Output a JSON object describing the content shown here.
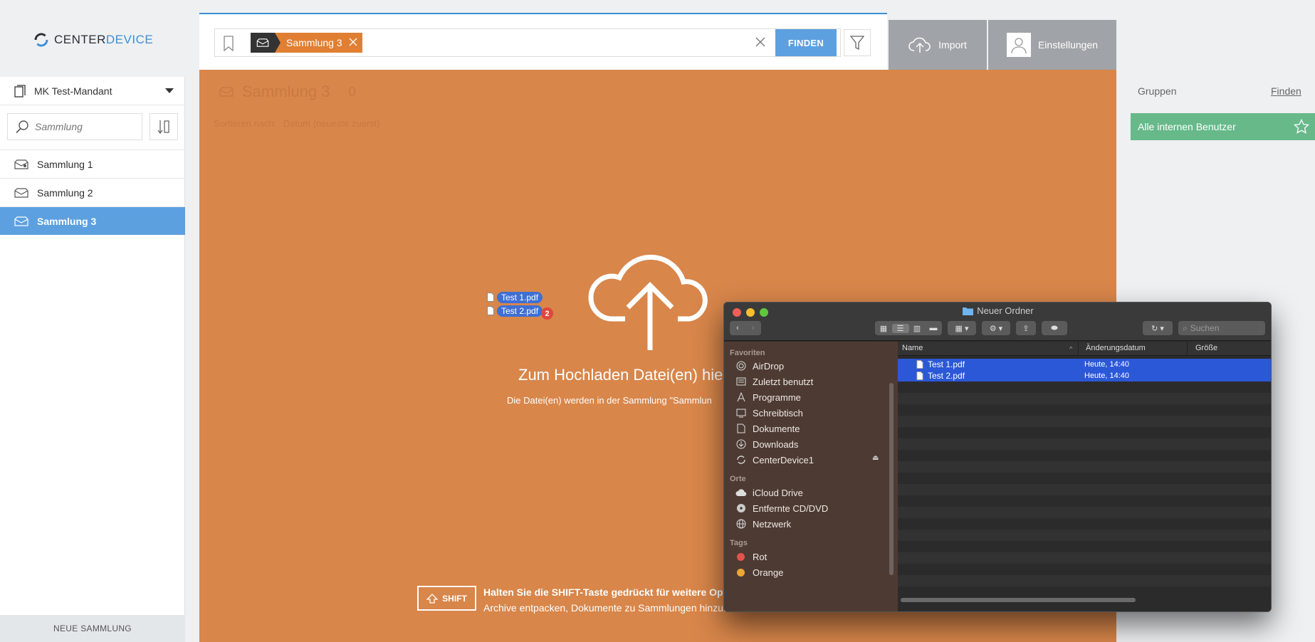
{
  "app": {
    "logo": {
      "part1": "CENTER",
      "part2": "DEVICE"
    },
    "tenant": "MK Test-Mandant"
  },
  "sidebar": {
    "search_placeholder": "Sammlung",
    "collections": [
      {
        "label": "Sammlung 1",
        "icon": "collection-shared-icon"
      },
      {
        "label": "Sammlung 2",
        "icon": "collection-icon"
      },
      {
        "label": "Sammlung 3",
        "icon": "collection-icon",
        "active": true
      }
    ],
    "new_collection": "NEUE SAMMLUNG"
  },
  "search": {
    "chip_label": "Sammlung 3",
    "find_label": "FINDEN"
  },
  "header_buttons": {
    "import": "Import",
    "settings": "Einstellungen"
  },
  "main": {
    "collection_title": "Sammlung 3",
    "collection_count": "0",
    "sort_label": "Sortieren nach:",
    "sort_value": "Datum (neueste zuerst)",
    "drop_title": "Zum Hochladen Datei(en) hier",
    "drop_subtitle": "Die Datei(en) werden in der Sammlung \"Sammlun",
    "dragged_files": [
      "Test 1.pdf",
      "Test 2.pdf"
    ],
    "drag_count": "2",
    "shift_key": "SHIFT",
    "shift_title": "Halten Sie die SHIFT-Taste gedrückt für weitere Optio",
    "shift_subtitle": "Archive entpacken, Dokumente zu Sammlungen hinzuf"
  },
  "right_panel": {
    "groups_label": "Gruppen",
    "find_link": "Finden",
    "group_item": "Alle internen Benutzer"
  },
  "finder": {
    "title": "Neuer Ordner",
    "search_placeholder": "Suchen",
    "sections": {
      "favorites": "Favoriten",
      "places": "Orte",
      "tags": "Tags"
    },
    "favorites": [
      "AirDrop",
      "Zuletzt benutzt",
      "Programme",
      "Schreibtisch",
      "Dokumente",
      "Downloads",
      "CenterDevice1"
    ],
    "places": [
      "iCloud Drive",
      "Entfernte CD/DVD",
      "Netzwerk"
    ],
    "tags": [
      {
        "label": "Rot",
        "color": "#e5524a"
      },
      {
        "label": "Orange",
        "color": "#f0a732"
      }
    ],
    "columns": {
      "name": "Name",
      "date": "Änderungsdatum",
      "size": "Größe"
    },
    "files": [
      {
        "name": "Test 1.pdf",
        "date": "Heute, 14:40"
      },
      {
        "name": "Test 2.pdf",
        "date": "Heute, 14:40"
      }
    ]
  },
  "colors": {
    "accent_blue": "#5da0e0",
    "drop_orange": "#d8864a",
    "chip_orange": "#e07f33",
    "group_green": "#67b98a",
    "finder_select": "#2b58d6"
  }
}
